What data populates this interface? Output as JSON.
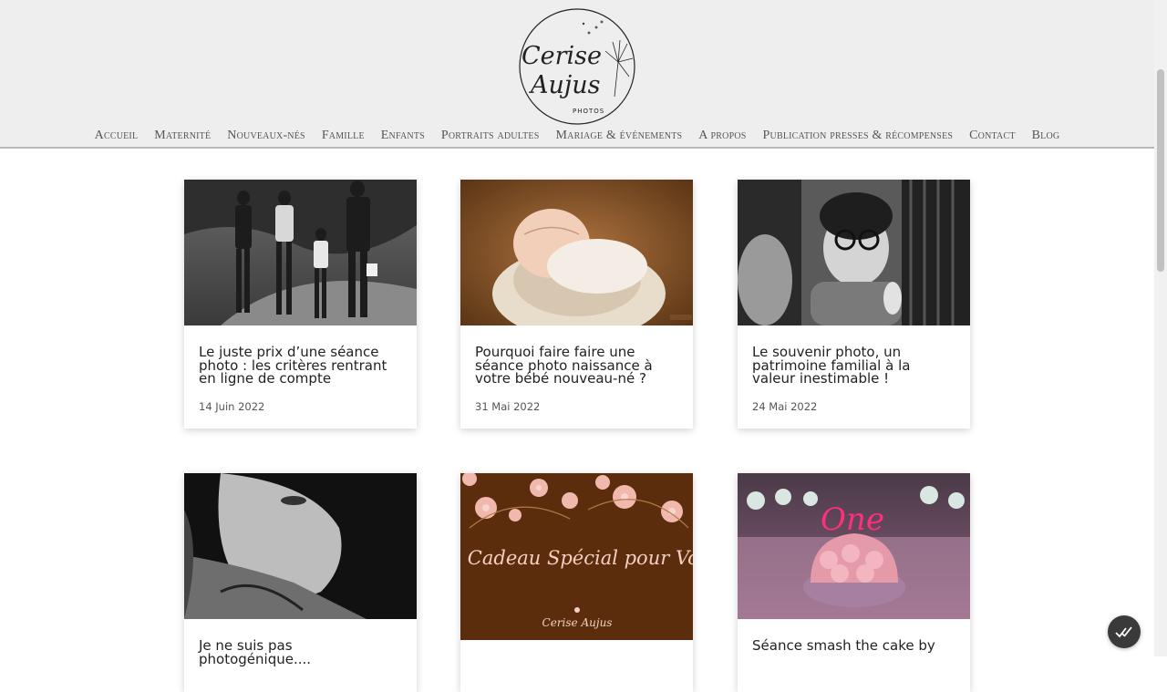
{
  "brand": {
    "logo_line1": "Cerise",
    "logo_line2": "Aujus",
    "logo_sub": "PHOTOS"
  },
  "nav": {
    "items": [
      {
        "label": "Accueil"
      },
      {
        "label": "Maternité"
      },
      {
        "label": "Nouveaux-nés"
      },
      {
        "label": "Famille"
      },
      {
        "label": "Enfants"
      },
      {
        "label": "Portraits adultes"
      },
      {
        "label": "Mariage & événements"
      },
      {
        "label": "A propos"
      },
      {
        "label": "Publication presses & récompenses"
      },
      {
        "label": "Contact"
      },
      {
        "label": "Blog"
      }
    ]
  },
  "posts": [
    {
      "title": "Le juste prix d’une séance photo : les critères rentrant en ligne de compte",
      "date": "14 Juin 2022"
    },
    {
      "title": "Pourquoi faire faire une séance photo naissance à votre bébé nouveau-né ?",
      "date": "31 Mai 2022"
    },
    {
      "title": "Le souvenir photo, un patrimoine familial à la valeur inestimable !",
      "date": "24 Mai 2022"
    },
    {
      "title": "Je ne suis pas photogénique....",
      "date": ""
    },
    {
      "title": "",
      "date": "",
      "image_text": "Un Cadeau Spécial pour Vous",
      "image_logo": "Cerise Aujus"
    },
    {
      "title": "Séance smash the cake by",
      "date": "",
      "image_text": "One"
    }
  ],
  "colors": {
    "header_bg": "#eeeeee",
    "chocolate": "#5c2d0c",
    "blossom": "#f2b8ad"
  }
}
